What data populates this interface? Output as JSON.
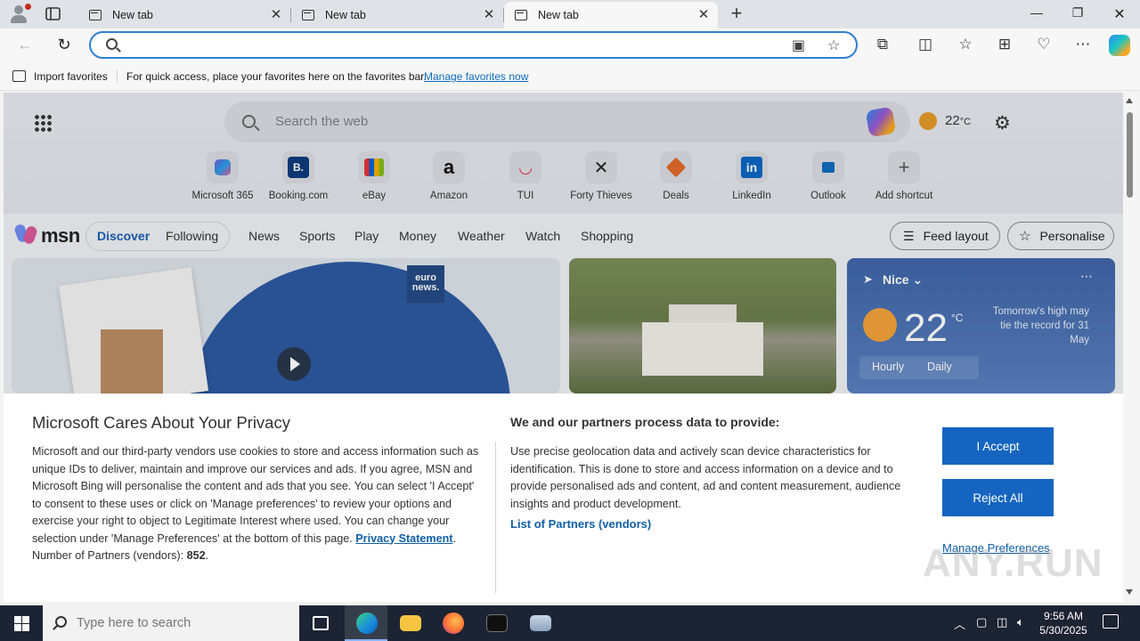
{
  "browser": {
    "tabs": [
      {
        "title": "New tab",
        "active": false
      },
      {
        "title": "New tab",
        "active": false
      },
      {
        "title": "New tab",
        "active": true
      }
    ],
    "address_placeholder": "",
    "address_value": ""
  },
  "favorites_bar": {
    "import_label": "Import favorites",
    "hint": "For quick access, place your favorites here on the favorites bar.",
    "manage_link": "Manage favorites now"
  },
  "newtab": {
    "search_placeholder": "Search the web",
    "weather_temp": "22",
    "weather_unit": "°C",
    "shortcuts": [
      {
        "label": "Microsoft 365",
        "icon": "microsoft-365-icon"
      },
      {
        "label": "Booking.com",
        "icon": "booking-icon",
        "glyph": "B."
      },
      {
        "label": "eBay",
        "icon": "ebay-icon"
      },
      {
        "label": "Amazon",
        "icon": "amazon-icon",
        "glyph": "a"
      },
      {
        "label": "TUI",
        "icon": "tui-icon"
      },
      {
        "label": "Forty Thieves",
        "icon": "forty-thieves-icon"
      },
      {
        "label": "Deals",
        "icon": "deals-icon"
      },
      {
        "label": "LinkedIn",
        "icon": "linkedin-icon",
        "glyph": "in"
      },
      {
        "label": "Outlook",
        "icon": "outlook-icon"
      },
      {
        "label": "Add shortcut",
        "icon": "plus-icon",
        "glyph": "+"
      }
    ],
    "msn_logo": "msn",
    "nav": {
      "discover": "Discover",
      "following": "Following",
      "links": [
        "News",
        "Sports",
        "Play",
        "Money",
        "Weather",
        "Watch",
        "Shopping"
      ]
    },
    "feed_layout": "Feed layout",
    "personalise": "Personalise",
    "news_badge": "euro news.",
    "weather_card": {
      "location": "Nice",
      "temp": "22",
      "unit": "°C",
      "note": "Tomorrow's high may tie the record for 31 May",
      "hourly": "Hourly",
      "daily": "Daily"
    }
  },
  "consent": {
    "title": "Microsoft Cares About Your Privacy",
    "body": "Microsoft and our third-party vendors use cookies to store and access information such as unique IDs to deliver, maintain and improve our services and ads. If you agree, MSN and Microsoft Bing will personalise the content and ads that you see. You can select 'I Accept' to consent to these uses or click on 'Manage preferences' to review your options and exercise your right to object to Legitimate Interest where used.  You can change your selection under 'Manage Preferences' at the bottom of this page.",
    "privacy_link": "Privacy Statement",
    "partners_label": "Number of Partners (vendors):",
    "partners_count": "852",
    "purpose_heading": "We and our partners process data to provide:",
    "purpose_text": "Use precise geolocation data and actively scan device characteristics for identification. This is done to store and access information on a device and to provide personalised ads and content, ad and content measurement, audience insights and product development.",
    "partners_link": "List of Partners (vendors)",
    "accept": "I Accept",
    "reject": "Reject All",
    "manage": "Manage Preferences"
  },
  "watermark": "ANY.RUN",
  "taskbar": {
    "search_placeholder": "Type here to search",
    "time": "9:56 AM",
    "date": "5/30/2025"
  }
}
